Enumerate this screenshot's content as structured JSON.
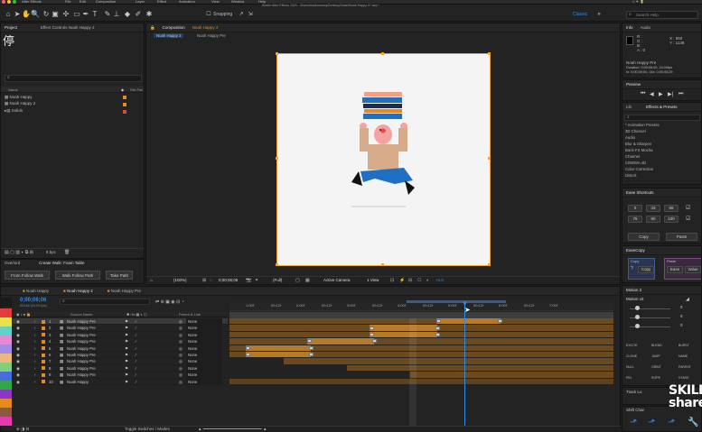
{
  "menu": {
    "app_name": "After Effects",
    "items": [
      "File",
      "Edit",
      "Composition",
      "Layer",
      "Effect",
      "Animation",
      "View",
      "Window",
      "Help"
    ],
    "window_title": "Adobe After Effects 2020 - /Users/studiomaxxy/Desktop/Noah/Noah Happy 07.aep *"
  },
  "toolbar": {
    "snapping_label": "Snapping",
    "workspace_label": "Classic",
    "search_placeholder": "Search Help"
  },
  "project_panel": {
    "tab": "Project",
    "effect_controls_tab": "Effect Controls Noah Happy 2",
    "search_icon": "search-icon",
    "column_name": "Name",
    "column_type": "File Pat",
    "items": [
      {
        "name": "Noah Happy",
        "color": "#e68a1f"
      },
      {
        "name": "Noah Happy 2",
        "color": "#e68a1f"
      },
      {
        "name": "Solids",
        "color": "#d94a4a"
      }
    ],
    "bpc": "8 bpc",
    "flow_label": "Overlord",
    "flow_value": "Create Walk: Foam Table",
    "buttons": [
      "From Follow Walk",
      "Walk Follow Path",
      "Take Path"
    ]
  },
  "composition": {
    "tab_prefix": "Composition",
    "tab_name": "Noah Happy 2",
    "sub_tabs": [
      "Noah Happy 2",
      "Noah Happy Pre"
    ],
    "zoom": "(100%)",
    "timecode": "0;00;06;06",
    "quality": "(Full)",
    "camera": "Active Camera",
    "views": "1 View",
    "offset": "+0.0"
  },
  "info_panel": {
    "tab_info": "Info",
    "tab_audio": "Audio",
    "values": [
      "R :",
      "G :",
      "B :",
      "A : 0"
    ],
    "coords": [
      "X : 650",
      "Y : 1138"
    ],
    "layer_name": "Noah Happy Pre",
    "duration": "Duration: 0;00;06;00, 24.00fps",
    "in_out": "In: 0;00;00;00, Out: 0;00;05;29"
  },
  "preview_panel": {
    "tab": "Preview"
  },
  "effects_panel": {
    "tab_lib": "Lib",
    "tab": "Effects & Presets",
    "items": [
      "* Animation Presets",
      "3D Channel",
      "Audio",
      "Blur & Sharpen",
      "Boris FX Mocha",
      "Channel",
      "CINEMA 4D",
      "Color Correction",
      "Distort"
    ]
  },
  "shortcuts_panel": {
    "tab": "Ease Shortcuts",
    "values": [
      "0",
      "33",
      "66",
      "75",
      "90",
      "100"
    ],
    "copy_label": "Copy",
    "paste_label": "Paste"
  },
  "easecopy_panel": {
    "tab": "EaseCopy",
    "copy_label": "Copy",
    "paste_label": "Paste",
    "buttons": [
      "Copy",
      "Ease",
      "Value"
    ]
  },
  "motion_panel": {
    "tab": "Motion 2",
    "dropdown": "Motion v2",
    "tools": [
      "EXCITE",
      "BLEND",
      "BURST",
      "CLONE",
      "JUMP",
      "NAME",
      "NULL",
      "ORBIT",
      "PARENT",
      "PIN",
      "ROPE",
      "STARE"
    ]
  },
  "track_panel": {
    "tab": "Track Lo"
  },
  "shift_panel": {
    "tab": "Shift Char"
  },
  "timeline": {
    "tabs": [
      "Noah Happy",
      "Noah Happy 2",
      "Noah Happy Pre"
    ],
    "timecode": "0;00;06;06",
    "frame_info": "00148 (24.00 fps)",
    "column_source": "Source Name",
    "column_parent": "Parent & Link",
    "ruler": [
      "1:00f",
      "00:12f",
      "2:00f",
      "00:12f",
      "3:00f",
      "00:12f",
      "4:00f",
      "00:12f",
      "5:00f",
      "00:12f",
      "6:00f",
      "00:12f",
      "7:00f"
    ],
    "layers": [
      {
        "num": "1",
        "name": "Noah Happy Pre",
        "parent": "None",
        "color": "#e68a1f",
        "selected": true
      },
      {
        "num": "2",
        "name": "Noah Happy Pre",
        "parent": "None",
        "color": "#e68a1f"
      },
      {
        "num": "3",
        "name": "Noah Happy Pre",
        "parent": "None",
        "color": "#e68a1f"
      },
      {
        "num": "4",
        "name": "Noah Happy Pre",
        "parent": "None",
        "color": "#e68a1f"
      },
      {
        "num": "5",
        "name": "Noah Happy Pre",
        "parent": "None",
        "color": "#e68a1f"
      },
      {
        "num": "6",
        "name": "Noah Happy Pre",
        "parent": "None",
        "color": "#e68a1f"
      },
      {
        "num": "7",
        "name": "Noah Happy Pre",
        "parent": "None",
        "color": "#e68a1f"
      },
      {
        "num": "8",
        "name": "Noah Happy Pre",
        "parent": "None",
        "color": "#e68a1f"
      },
      {
        "num": "9",
        "name": "Noah Happy Pre",
        "parent": "None",
        "color": "#e68a1f"
      },
      {
        "num": "10",
        "name": "Noah Happy",
        "parent": "None",
        "color": "#e68a1f"
      }
    ],
    "toggle_label": "Toggle Switches / Modes"
  },
  "watermark": {
    "line1": "SKILL",
    "line2": "share."
  },
  "colors": {
    "accent": "#2d8ceb",
    "orange": "#e68a1f",
    "track_brown": "#6b4a20",
    "track_light": "#b57a2a"
  }
}
